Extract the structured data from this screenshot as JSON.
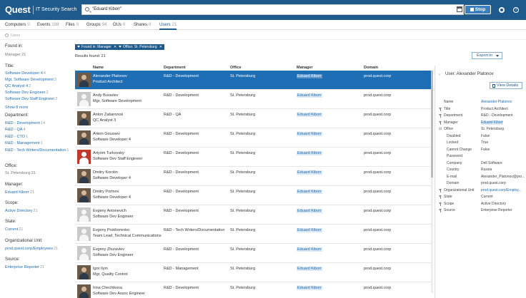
{
  "header": {
    "brand": "Quest",
    "product": "IT Security Search",
    "search_value": "\"Eduard Kiborr\"",
    "stop_label": "Stop"
  },
  "tabs": [
    {
      "label": "Computers",
      "count": "0"
    },
    {
      "label": "Events",
      "count": "198"
    },
    {
      "label": "Files",
      "count": "0"
    },
    {
      "label": "Groups",
      "count": "94"
    },
    {
      "label": "OUs",
      "count": "0"
    },
    {
      "label": "Shares",
      "count": "0"
    },
    {
      "label": "Users",
      "count": "21"
    }
  ],
  "subbar_label": "Users",
  "sidebar": {
    "found_in_title": "Found in:",
    "found_in_items": [
      {
        "label": "Manager",
        "count": "21"
      }
    ],
    "title_title": "Title:",
    "title_items": [
      {
        "label": "Software Developer 4",
        "count": "4"
      },
      {
        "label": "Mgr, Software Development",
        "count": "3"
      },
      {
        "label": "QC Analyst 4",
        "count": "2"
      },
      {
        "label": "Software Dev Engineer",
        "count": "2"
      },
      {
        "label": "Software Dev Staff Engineer",
        "count": "2"
      }
    ],
    "show_more": "Show 8 more",
    "department_title": "Department:",
    "department_items": [
      {
        "label": "R&D - Development",
        "count": "14"
      },
      {
        "label": "R&D - QA",
        "count": "4"
      },
      {
        "label": "R&D - CTO",
        "count": "1"
      },
      {
        "label": "R&D - Management",
        "count": "1"
      },
      {
        "label": "R&D - Tech Writers/Documentation",
        "count": "1"
      }
    ],
    "office_title": "Office:",
    "office_items": [
      {
        "label": "St. Petersburg",
        "count": "21"
      }
    ],
    "manager_title": "Manager:",
    "manager_items": [
      {
        "label": "Eduard Kiborr",
        "count": "21"
      }
    ],
    "scope_title": "Scope:",
    "scope_items": [
      {
        "label": "Active Directory",
        "count": "21"
      }
    ],
    "state_title": "State:",
    "state_items": [
      {
        "label": "Current",
        "count": "21"
      }
    ],
    "ou_title": "Organizational Unit:",
    "ou_items": [
      {
        "label": "prod.quest.corp/Employees",
        "count": "21"
      }
    ],
    "source_title": "Source:",
    "source_items": [
      {
        "label": "Enterprise Reporter",
        "count": "21"
      }
    ]
  },
  "filters": [
    {
      "label": "Found in: Manager"
    },
    {
      "label": "Office: St. Petersburg"
    }
  ],
  "results_label": "Results found: 21",
  "export_label": "Export to",
  "columns": [
    "Name",
    "Department",
    "Office",
    "Manager",
    "Domain"
  ],
  "rows": [
    {
      "name": "Alexander Platonov",
      "title": "Product Architect",
      "department": "R&D - Development",
      "office": "St. Petersburg",
      "manager": "Eduard Kiborr",
      "domain": "prod.quest.corp",
      "avatar": "photo"
    },
    {
      "name": "Andy Buravlev",
      "title": "Mgr, Software Development",
      "department": "R&D - Development",
      "office": "St. Petersburg",
      "manager": "Eduard Kiborr",
      "domain": "prod.quest.corp",
      "avatar": "placeholder"
    },
    {
      "name": "Anton Zabaronok",
      "title": "QC Analyst 3",
      "department": "R&D - QA",
      "office": "St. Petersburg",
      "manager": "Eduard Kiborr",
      "domain": "prod.quest.corp",
      "avatar": "photo"
    },
    {
      "name": "Artem Goussev",
      "title": "Software Developer 4",
      "department": "R&D - Development",
      "office": "St. Petersburg",
      "manager": "Eduard Kiborr",
      "domain": "prod.quest.corp",
      "avatar": "photo"
    },
    {
      "name": "Artyom Turkovsky",
      "title": "Software Dev Staff Engineer",
      "department": "R&D - Development",
      "office": "St. Petersburg",
      "manager": "Eduard Kiborr",
      "domain": "prod.quest.corp",
      "avatar": "red"
    },
    {
      "name": "Dmitry Korotin",
      "title": "Software Developer 4",
      "department": "R&D - Development",
      "office": "St. Petersburg",
      "manager": "Eduard Kiborr",
      "domain": "prod.quest.corp",
      "avatar": "photo"
    },
    {
      "name": "Dmitry Portnov",
      "title": "Software Developer 4",
      "department": "R&D - Development",
      "office": "St. Petersburg",
      "manager": "Eduard Kiborr",
      "domain": "prod.quest.corp",
      "avatar": "photo"
    },
    {
      "name": "Evgeny Antonevich",
      "title": "Software Dev Engineer",
      "department": "R&D - Development",
      "office": "St. Petersburg",
      "manager": "Eduard Kiborr",
      "domain": "prod.quest.corp",
      "avatar": "placeholder"
    },
    {
      "name": "Evgeny Prokhorenko",
      "title": "Team Lead, Technical Communications",
      "department": "R&D - Tech Writers/Documentation",
      "office": "St. Petersburg",
      "manager": "Eduard Kiborr",
      "domain": "prod.quest.corp",
      "avatar": "placeholder"
    },
    {
      "name": "Evgeny Zhuravlev",
      "title": "Software Dev Engineer",
      "department": "R&D - Development",
      "office": "St. Petersburg",
      "manager": "Eduard Kiborr",
      "domain": "prod.quest.corp",
      "avatar": "placeholder"
    },
    {
      "name": "Igor Ilyin",
      "title": "Mgr, Quality Control",
      "department": "R&D - Management",
      "office": "St. Petersburg",
      "manager": "Eduard Kiborr",
      "domain": "prod.quest.corp",
      "avatar": "photo"
    },
    {
      "name": "Irina Chechikova",
      "title": "Software Dev Assoc Engineer",
      "department": "R&D - Development",
      "office": "St. Petersburg",
      "manager": "Eduard Kiborr",
      "domain": "prod.quest.corp",
      "avatar": "photo"
    }
  ],
  "detail": {
    "title": "User: Alexander Platonov",
    "view_details": "View Details",
    "properties": [
      {
        "key": "Name",
        "value": "Alexander Platonov",
        "style": "link",
        "icon": "none"
      },
      {
        "key": "Title",
        "value": "Product Architect",
        "style": "plain",
        "icon": "filter"
      },
      {
        "key": "Department",
        "value": "R&D - Development",
        "style": "plain",
        "icon": "filter"
      },
      {
        "key": "Manager",
        "value": "Eduard Kiborr",
        "style": "hl",
        "icon": "filter"
      },
      {
        "key": "Office",
        "value": "St. Petersburg",
        "style": "plain",
        "icon": "collapse"
      },
      {
        "key": "Disabled",
        "value": "False",
        "style": "plain",
        "icon": "indent"
      },
      {
        "key": "Locked",
        "value": "True",
        "style": "plain",
        "icon": "indent"
      },
      {
        "key": "Cannot Change",
        "value": "False",
        "style": "plain",
        "icon": "indent"
      },
      {
        "key": "Password",
        "value": "",
        "style": "plain",
        "icon": "indent"
      },
      {
        "key": "Company",
        "value": "Dell Software",
        "style": "plain",
        "icon": "indent"
      },
      {
        "key": "Country",
        "value": "Russia",
        "style": "plain",
        "icon": "indent"
      },
      {
        "key": "E-mail",
        "value": "Alexander_Platonov@pro...",
        "style": "plain",
        "icon": "indent"
      },
      {
        "key": "Domain",
        "value": "prod.quest.corp",
        "style": "plain",
        "icon": "indent"
      },
      {
        "key": "Organizational Unit",
        "value": "prod.quest.corp/Employ...",
        "style": "link",
        "icon": "filter"
      },
      {
        "key": "State",
        "value": "Current",
        "style": "plain",
        "icon": "filter"
      },
      {
        "key": "Scope",
        "value": "Active Directory",
        "style": "plain",
        "icon": "filter"
      },
      {
        "key": "Source",
        "value": "Enterprise Reporter",
        "style": "plain",
        "icon": "filter"
      }
    ]
  }
}
